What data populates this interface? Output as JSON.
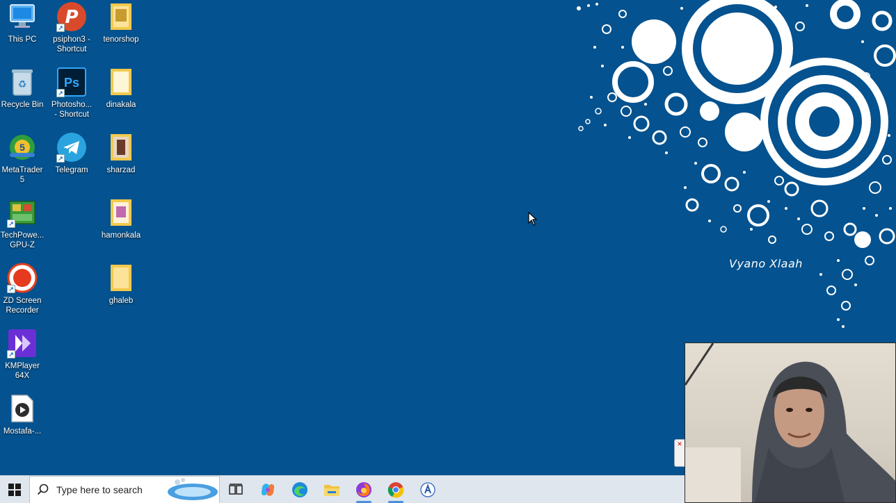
{
  "desktop": {
    "icons": [
      {
        "label": "This PC",
        "icon": "computer-icon"
      },
      {
        "label": "psiphon3 -\nShortcut",
        "icon": "psiphon-icon"
      },
      {
        "label": "tenorshop",
        "icon": "folder-icon"
      },
      {
        "label": "Recycle Bin",
        "icon": "recycle-bin-icon"
      },
      {
        "label": "Photosho...\n- Shortcut",
        "icon": "photoshop-icon"
      },
      {
        "label": "dinakala",
        "icon": "folder-icon"
      },
      {
        "label": "MetaTrader 5",
        "icon": "metatrader-icon"
      },
      {
        "label": "Telegram",
        "icon": "telegram-icon"
      },
      {
        "label": "sharzad",
        "icon": "folder-icon"
      },
      {
        "label": "TechPowe...\nGPU-Z",
        "icon": "gpuz-icon"
      },
      {
        "label": "hamonkala",
        "icon": "folder-icon"
      },
      {
        "label": "ZD Screen\nRecorder",
        "icon": "record-icon"
      },
      {
        "label": "ghaleb",
        "icon": "folder-icon"
      },
      {
        "label": "KMPlayer\n64X",
        "icon": "kmplayer-icon"
      },
      {
        "label": "Mostafa-...",
        "icon": "video-file-icon"
      }
    ]
  },
  "wallpaper": {
    "brand_text": "Vyano Xlaah",
    "background_color": "#04528f"
  },
  "taskbar": {
    "search_placeholder": "Type here to search",
    "apps": [
      "task-view-icon",
      "copilot-icon",
      "edge-icon",
      "file-explorer-icon",
      "firefox-icon",
      "chrome-icon",
      "app-icon"
    ]
  }
}
